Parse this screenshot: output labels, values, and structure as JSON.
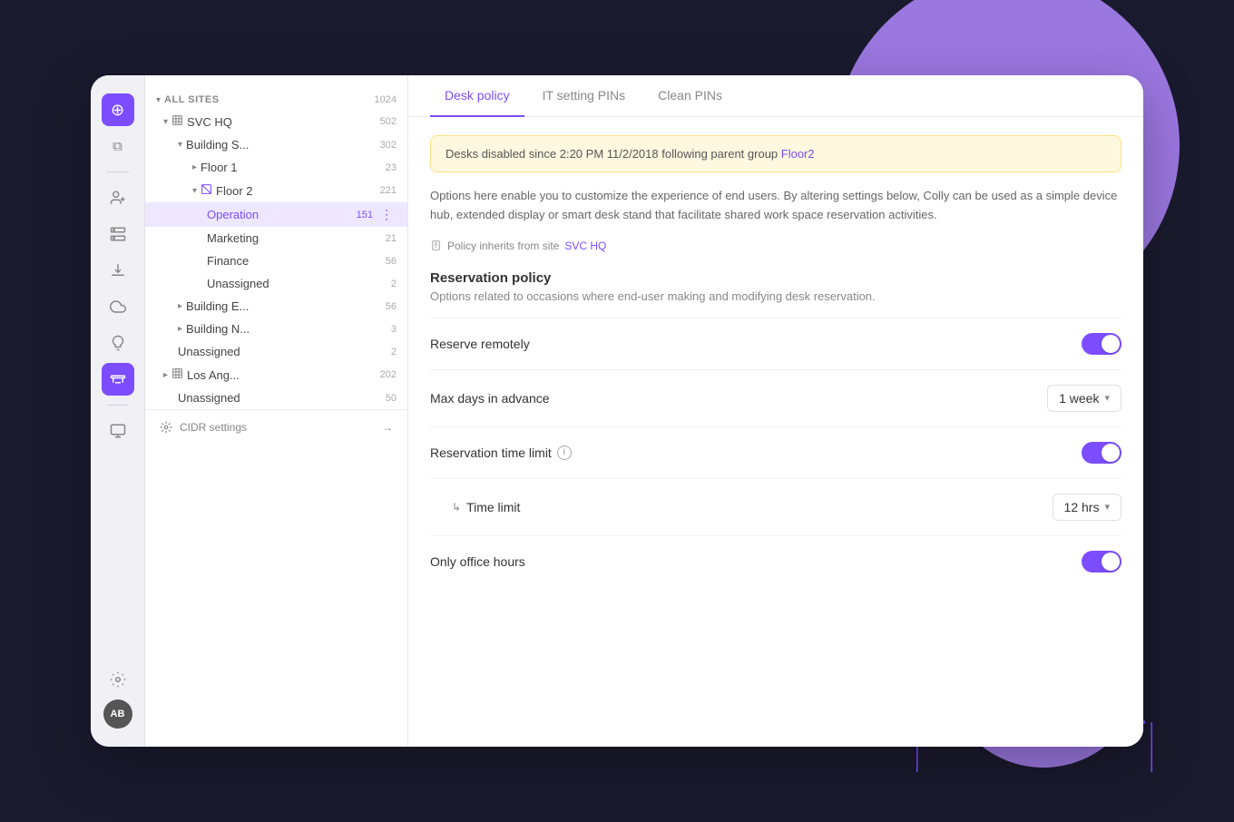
{
  "background": {
    "color": "#1a1a2e"
  },
  "nav": {
    "icons": [
      {
        "name": "logo-icon",
        "glyph": "⊕",
        "active": true
      },
      {
        "name": "layers-icon",
        "glyph": "⧉",
        "active": false
      },
      {
        "name": "divider1",
        "type": "divider"
      },
      {
        "name": "people-icon",
        "glyph": "⊞",
        "active": false
      },
      {
        "name": "server-icon",
        "glyph": "◉",
        "active": false
      },
      {
        "name": "download-icon",
        "glyph": "⬇",
        "active": false
      },
      {
        "name": "cloud-icon",
        "glyph": "☁",
        "active": false
      },
      {
        "name": "bulb-icon",
        "glyph": "💡",
        "active": false
      },
      {
        "name": "desk-icon",
        "glyph": "⊟",
        "active": true
      },
      {
        "name": "divider2",
        "type": "divider"
      },
      {
        "name": "monitor-icon",
        "glyph": "⊡",
        "active": false
      }
    ],
    "settings_icon": "⚙",
    "avatar_initials": "AB"
  },
  "sidebar": {
    "all_sites_label": "ALL SITES",
    "all_sites_count": "1024",
    "items": [
      {
        "level": 1,
        "label": "SVC HQ",
        "count": "502",
        "icon": "🏢",
        "expanded": true
      },
      {
        "level": 2,
        "label": "Building S...",
        "count": "302",
        "expanded": true
      },
      {
        "level": 3,
        "label": "Floor 1",
        "count": "23",
        "expanded": false
      },
      {
        "level": 3,
        "label": "Floor 2",
        "count": "221",
        "expanded": true,
        "icon_special": true
      },
      {
        "level": 4,
        "label": "Operation",
        "count": "151",
        "active": true,
        "show_more": true
      },
      {
        "level": 4,
        "label": "Marketing",
        "count": "21"
      },
      {
        "level": 4,
        "label": "Finance",
        "count": "56"
      },
      {
        "level": 4,
        "label": "Unassigned",
        "count": "2"
      },
      {
        "level": 2,
        "label": "Building E...",
        "count": "56",
        "expanded": false
      },
      {
        "level": 2,
        "label": "Building N...",
        "count": "3",
        "expanded": false
      },
      {
        "level": 2,
        "label": "Unassigned",
        "count": "2"
      },
      {
        "level": 1,
        "label": "Los Ang...",
        "count": "202",
        "icon": "🏢",
        "expanded": false
      },
      {
        "level": 2,
        "label": "Unassigned",
        "count": "50"
      }
    ],
    "footer_label": "CIDR settings",
    "footer_arrow": "→"
  },
  "tabs": [
    {
      "id": "desk-policy",
      "label": "Desk policy",
      "active": true
    },
    {
      "id": "it-setting-pins",
      "label": "IT setting PINs",
      "active": false
    },
    {
      "id": "clean-pins",
      "label": "Clean PINs",
      "active": false
    }
  ],
  "alert": {
    "text": "Desks disabled since 2:20 PM 11/2/2018 following parent group ",
    "link": "Floor2"
  },
  "description": "Options here enable you to customize the experience of end users. By altering settings below, Colly can be used as a simple device hub, extended display or smart desk stand that facilitate shared work space reservation activities.",
  "policy_inherit": {
    "label": "Policy inherits from site ",
    "link": "SVC HQ"
  },
  "reservation_policy": {
    "title": "Reservation policy",
    "description": "Options related to occasions where end-user making and modifying desk reservation.",
    "rows": [
      {
        "id": "reserve-remotely",
        "label": "Reserve remotely",
        "control_type": "toggle",
        "toggle_on": true
      },
      {
        "id": "max-days-advance",
        "label": "Max days in advance",
        "control_type": "dropdown",
        "value": "1 week"
      },
      {
        "id": "reservation-time-limit",
        "label": "Reservation time limit",
        "has_info": true,
        "control_type": "toggle",
        "toggle_on": true
      },
      {
        "id": "time-limit",
        "label": "Time limit",
        "sub": true,
        "control_type": "dropdown",
        "value": "12 hrs"
      },
      {
        "id": "only-office-hours",
        "label": "Only office hours",
        "control_type": "toggle",
        "toggle_on": true
      }
    ]
  }
}
